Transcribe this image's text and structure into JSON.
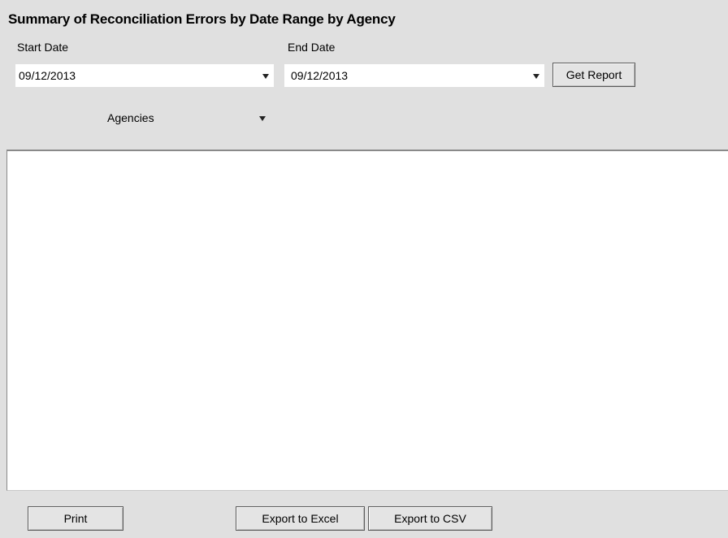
{
  "title": "Summary of Reconciliation Errors by Date Range by Agency",
  "filters": {
    "start_date_label": "Start Date",
    "start_date_value": "09/12/2013",
    "end_date_label": "End Date",
    "end_date_value": "09/12/2013",
    "agencies_label": "Agencies"
  },
  "buttons": {
    "get_report": "Get Report",
    "print": "Print",
    "export_excel": "Export to Excel",
    "export_csv": "Export to CSV"
  },
  "icons": {
    "dropdown": "chevron-down-icon"
  }
}
